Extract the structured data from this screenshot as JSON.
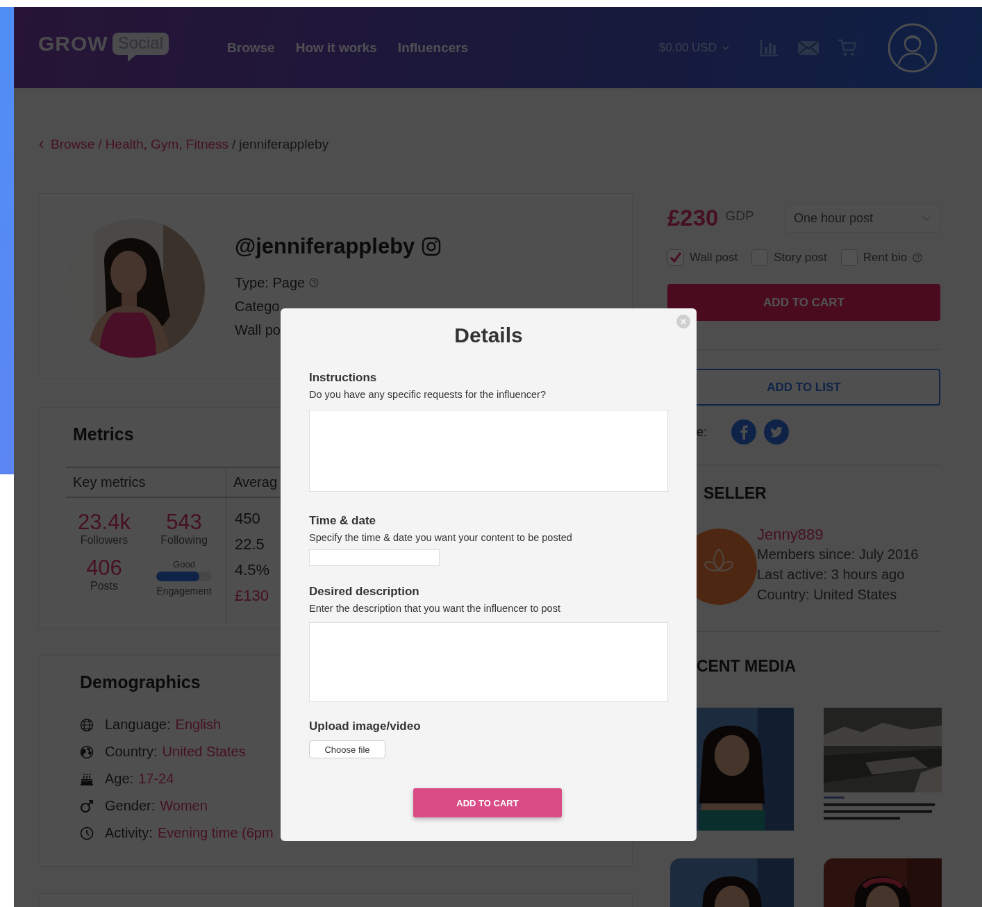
{
  "header": {
    "logo_word": "GROW",
    "logo_badge": "Social",
    "nav": [
      "Browse",
      "How it works",
      "Influencers"
    ],
    "currency": "$0.00 USD"
  },
  "breadcrumb": {
    "separator": "/",
    "items": [
      {
        "label": "Browse",
        "link": true
      },
      {
        "label": "Health, Gym, Fitness",
        "link": true
      },
      {
        "label": "jenniferappleby",
        "link": false
      }
    ]
  },
  "profile": {
    "username": "@jenniferappleby",
    "type": "Type: Page",
    "categories": "Catego",
    "wall": "Wall po"
  },
  "metrics": {
    "title": "Metrics",
    "columns": [
      "Key metrics",
      "Averag"
    ],
    "key": [
      {
        "value": "23.4k",
        "label": "Followers"
      },
      {
        "value": "543",
        "label": "Following"
      },
      {
        "value": "406",
        "label": "Posts"
      }
    ],
    "engagement": {
      "rating": "Good",
      "label": "Engagement",
      "level": 0.78
    },
    "averages": [
      {
        "value": "450",
        "kind": "plain"
      },
      {
        "value": "22.5",
        "kind": "plain"
      },
      {
        "value": "4.5%",
        "kind": "plain"
      },
      {
        "value": "£130",
        "kind": "price"
      }
    ]
  },
  "demographics": {
    "title": "Demographics",
    "rows": [
      {
        "kind": "globe",
        "label": "Language:",
        "value": "English"
      },
      {
        "kind": "earth",
        "label": "Country:",
        "value": "United States"
      },
      {
        "kind": "cake",
        "label": "Age:",
        "value": "17-24"
      },
      {
        "kind": "gender",
        "label": "Gender:",
        "value": "Women"
      },
      {
        "kind": "clock",
        "label": "Activity:",
        "value": "Evening time (6pm"
      }
    ]
  },
  "offer": {
    "price": "£230",
    "currency": "GDP",
    "package": "One hour post",
    "options": [
      {
        "label": "Wall post",
        "checked": true,
        "help": false
      },
      {
        "label": "Story post",
        "checked": false,
        "help": false
      },
      {
        "label": "Rent bio",
        "checked": false,
        "help": true
      }
    ],
    "cart_button": "ADD TO CART",
    "list_button": "ADD TO LIST",
    "share_label": "e:"
  },
  "seller": {
    "heading": "SELLER",
    "name": "Jenny889",
    "details": [
      "Members since: July 2016",
      "Last active: 3 hours ago",
      "Country: United States"
    ]
  },
  "media": {
    "heading": "CENT MEDIA",
    "items": [
      {
        "kind": "picture"
      },
      {
        "kind": "article"
      },
      {
        "kind": "picture"
      },
      {
        "kind": "picture"
      }
    ]
  },
  "modal": {
    "title": "Details",
    "fields": [
      {
        "kind": "textarea",
        "label": "Instructions",
        "hint": "Do you have any specific requests for the influencer?"
      },
      {
        "kind": "input",
        "label": "Time & date",
        "hint": "Specify the time & date you want your content to be posted"
      },
      {
        "kind": "textarea",
        "label": "Desired description",
        "hint": "Enter the description that you want the influencer to post"
      },
      {
        "kind": "file",
        "label": "Upload image/video",
        "button": "Choose file"
      }
    ],
    "submit": "ADD TO CART"
  }
}
